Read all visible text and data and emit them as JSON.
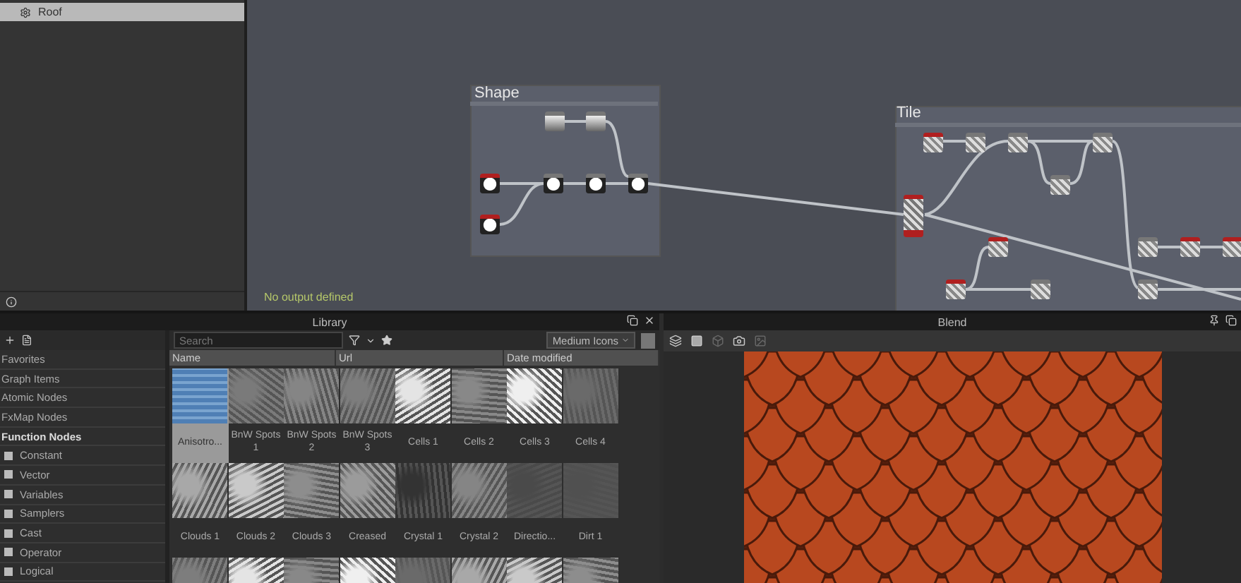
{
  "explorer": {
    "items": [
      {
        "label": "Roof",
        "selected": true
      }
    ]
  },
  "graph": {
    "status": "No output defined",
    "frames": [
      {
        "title": "Shape"
      },
      {
        "title": "Tile"
      }
    ]
  },
  "library": {
    "title": "Library",
    "search": {
      "placeholder": "Search"
    },
    "view_mode": "Medium Icons",
    "columns": [
      "Name",
      "Url",
      "Date modified"
    ],
    "categories": [
      {
        "label": "Favorites",
        "kind": "section"
      },
      {
        "label": "Graph Items",
        "kind": "section"
      },
      {
        "label": "Atomic Nodes",
        "kind": "section"
      },
      {
        "label": "FxMap Nodes",
        "kind": "section"
      },
      {
        "label": "Function Nodes",
        "kind": "header"
      },
      {
        "label": "Constant",
        "kind": "item"
      },
      {
        "label": "Vector",
        "kind": "item"
      },
      {
        "label": "Variables",
        "kind": "item"
      },
      {
        "label": "Samplers",
        "kind": "item"
      },
      {
        "label": "Cast",
        "kind": "item"
      },
      {
        "label": "Operator",
        "kind": "item"
      },
      {
        "label": "Logical",
        "kind": "item"
      }
    ],
    "items": [
      {
        "label": "Anisotro...",
        "selected": true
      },
      {
        "label": "BnW Spots 1",
        "selected": false
      },
      {
        "label": "BnW Spots 2",
        "selected": false
      },
      {
        "label": "BnW Spots 3",
        "selected": false
      },
      {
        "label": "Cells 1",
        "selected": false
      },
      {
        "label": "Cells 2",
        "selected": false
      },
      {
        "label": "Cells 3",
        "selected": false
      },
      {
        "label": "Cells 4",
        "selected": false
      },
      {
        "label": "Clouds 1",
        "selected": false
      },
      {
        "label": "Clouds 2",
        "selected": false
      },
      {
        "label": "Clouds 3",
        "selected": false
      },
      {
        "label": "Creased",
        "selected": false
      },
      {
        "label": "Crystal 1",
        "selected": false
      },
      {
        "label": "Crystal 2",
        "selected": false
      },
      {
        "label": "Directio...",
        "selected": false
      },
      {
        "label": "Dirt 1",
        "selected": false
      }
    ]
  },
  "preview": {
    "title": "Blend"
  }
}
